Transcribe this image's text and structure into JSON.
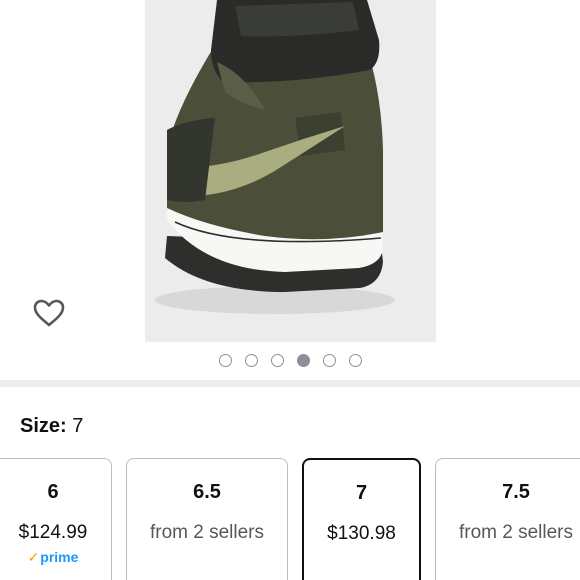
{
  "gallery": {
    "image_alt": "Olive green suede high-top sneaker, rear view",
    "dot_count": 6,
    "active_dot": 3
  },
  "size": {
    "label": "Size:",
    "value": "7"
  },
  "size_options": [
    {
      "size": "6",
      "price": "$124.99",
      "badge": "prime",
      "selected": false
    },
    {
      "size": "6.5",
      "price": "from 2 sellers",
      "badge": "",
      "selected": false
    },
    {
      "size": "7",
      "price": "$130.98",
      "badge": "",
      "selected": true
    },
    {
      "size": "7.5",
      "price": "from 2 sellers",
      "badge": "",
      "selected": false
    }
  ],
  "colors": {
    "prime_blue": "#1a98ff",
    "prime_check": "#ff9900",
    "dot_gray": "#8d9096",
    "card_border": "#bbbfbf"
  }
}
